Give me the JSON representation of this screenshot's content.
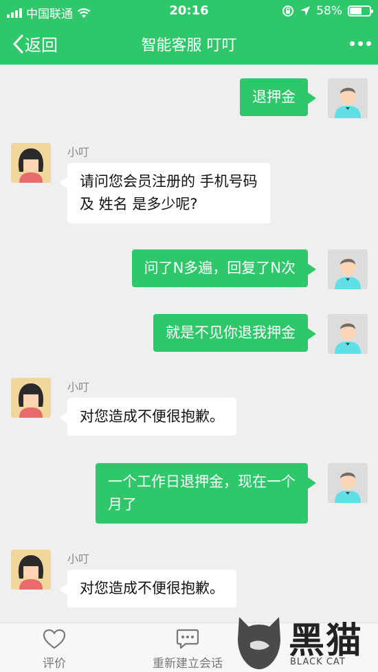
{
  "status_bar": {
    "carrier": "中国联通",
    "time": "20:16",
    "battery": "58%",
    "battery_level": 0.58,
    "icons": [
      "signal-icon",
      "wifi-icon",
      "orientation-lock-icon",
      "location-icon",
      "battery-icon"
    ]
  },
  "nav": {
    "back_label": "返回",
    "title": "智能客服 叮叮",
    "more_icon": "more-icon"
  },
  "messages": [
    {
      "sender": "me",
      "lines": [
        "退押金"
      ]
    },
    {
      "sender": "bot",
      "name": "小叮",
      "lines": [
        "请问您会员注册的 手机号码",
        "及 姓名 是多少呢?"
      ]
    },
    {
      "sender": "me",
      "lines": [
        "问了N多遍，回复了N次"
      ]
    },
    {
      "sender": "me",
      "lines": [
        "就是不见你退我押金"
      ]
    },
    {
      "sender": "bot",
      "name": "小叮",
      "lines": [
        "对您造成不便很抱歉。"
      ]
    },
    {
      "sender": "me",
      "lines": [
        "一个工作日退押金，现在一个",
        "月了"
      ]
    },
    {
      "sender": "bot",
      "name": "小叮",
      "lines": [
        "对您造成不便很抱歉。"
      ]
    }
  ],
  "footer": {
    "rate_label": "评价",
    "rate_icon": "heart-icon",
    "restart_label": "重新建立会话",
    "restart_icon": "chat-bubble-icon"
  },
  "watermark": {
    "big": "黑猫",
    "small": "BLACK CAT"
  },
  "colors": {
    "brand_green": "#2ec86b",
    "background": "#efefef",
    "bot_bubble": "#ffffff"
  }
}
